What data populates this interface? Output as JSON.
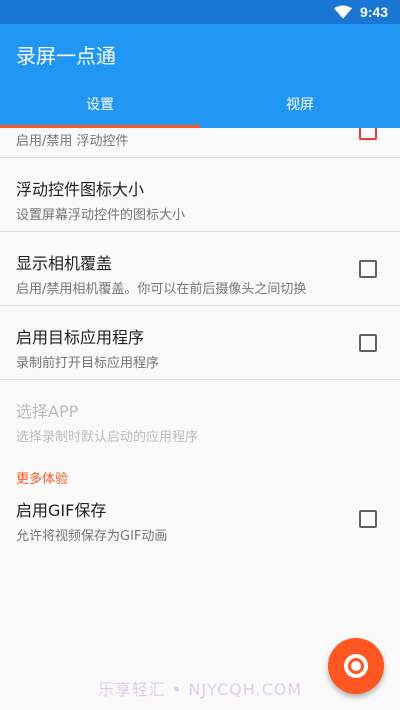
{
  "status_bar": {
    "time": "9:43"
  },
  "app_bar": {
    "title": "录屏一点通"
  },
  "tabs": [
    {
      "label": "设置",
      "active": true
    },
    {
      "label": "视屏",
      "active": false
    }
  ],
  "settings": {
    "floating_toggle": {
      "summary": "启用/禁用 浮动控件"
    },
    "floating_icon_size": {
      "title": "浮动控件图标大小",
      "summary": "设置屏幕浮动控件的图标大小"
    },
    "camera_overlay": {
      "title": "显示相机覆盖",
      "summary": "启用/禁用相机覆盖。你可以在前后摄像头之间切换",
      "checked": false
    },
    "target_app": {
      "title": "启用目标应用程序",
      "summary": "录制前打开目标应用程序",
      "checked": false
    },
    "choose_app": {
      "title": "选择APP",
      "summary": "选择录制时默认启动的应用程序",
      "enabled": false
    },
    "more_section": {
      "header": "更多体验"
    },
    "gif_save": {
      "title": "启用GIF保存",
      "summary": "允许将视频保存为GIF动画",
      "checked": false
    }
  },
  "fab": {
    "icon": "record-icon"
  },
  "watermark": "乐享轻汇 • NJYCQH.COM",
  "colors": {
    "primary": "#2196f3",
    "primary_dark": "#1976d2",
    "accent": "#ff5722"
  }
}
